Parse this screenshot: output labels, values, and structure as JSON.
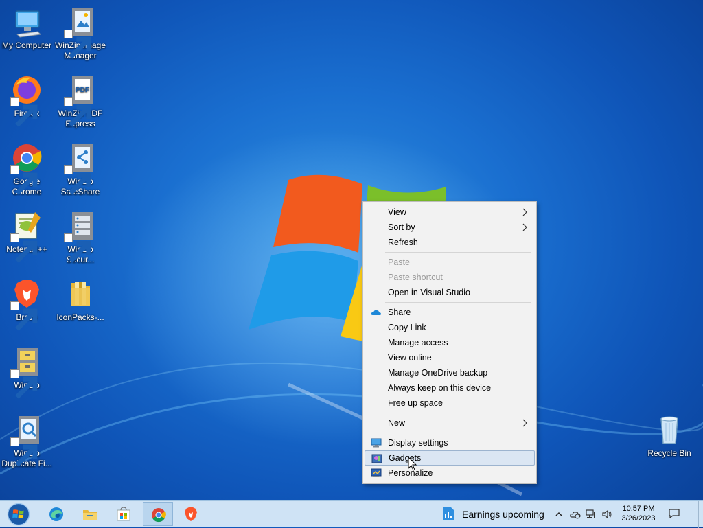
{
  "desktop": {
    "icons": [
      {
        "label": "My Computer",
        "icon": "computer-icon"
      },
      {
        "label": "WinZip Image Manager",
        "icon": "winzip-image-icon"
      },
      {
        "label": "Firefox",
        "icon": "firefox-icon"
      },
      {
        "label": "WinZip PDF Express",
        "icon": "winzip-pdf-icon"
      },
      {
        "label": "Google Chrome",
        "icon": "chrome-icon"
      },
      {
        "label": "WinZip SafeShare",
        "icon": "winzip-safeshare-icon"
      },
      {
        "label": "Notepad++",
        "icon": "notepadpp-icon"
      },
      {
        "label": "WinZip Secur...",
        "icon": "winzip-secure-icon"
      },
      {
        "label": "Brave",
        "icon": "brave-icon"
      },
      {
        "label": "IconPacks-...",
        "icon": "folder-icon"
      },
      {
        "label": "WinZip",
        "icon": "winzip-icon"
      },
      {
        "label": "WinZip Duplicate Fi...",
        "icon": "winzip-duplicate-icon"
      },
      {
        "label": "Recycle Bin",
        "icon": "recycle-bin-icon"
      }
    ]
  },
  "context_menu": {
    "items": [
      {
        "label": "View"
      },
      {
        "label": "Sort by"
      },
      {
        "label": "Refresh"
      },
      {
        "label": "Paste"
      },
      {
        "label": "Paste shortcut"
      },
      {
        "label": "Open in Visual Studio"
      },
      {
        "label": "Share"
      },
      {
        "label": "Copy Link"
      },
      {
        "label": "Manage access"
      },
      {
        "label": "View online"
      },
      {
        "label": "Manage OneDrive backup"
      },
      {
        "label": "Always keep on this device"
      },
      {
        "label": "Free up space"
      },
      {
        "label": "New"
      },
      {
        "label": "Display settings"
      },
      {
        "label": "Gadgets"
      },
      {
        "label": "Personalize"
      }
    ]
  },
  "taskbar": {
    "news_label": "Earnings upcoming",
    "time": "10:57 PM",
    "date": "3/26/2023"
  },
  "colors": {
    "desktop_blue": "#1a6fd0",
    "taskbar": "#cfe3f5",
    "menu_hover": "#dbe6f3"
  }
}
